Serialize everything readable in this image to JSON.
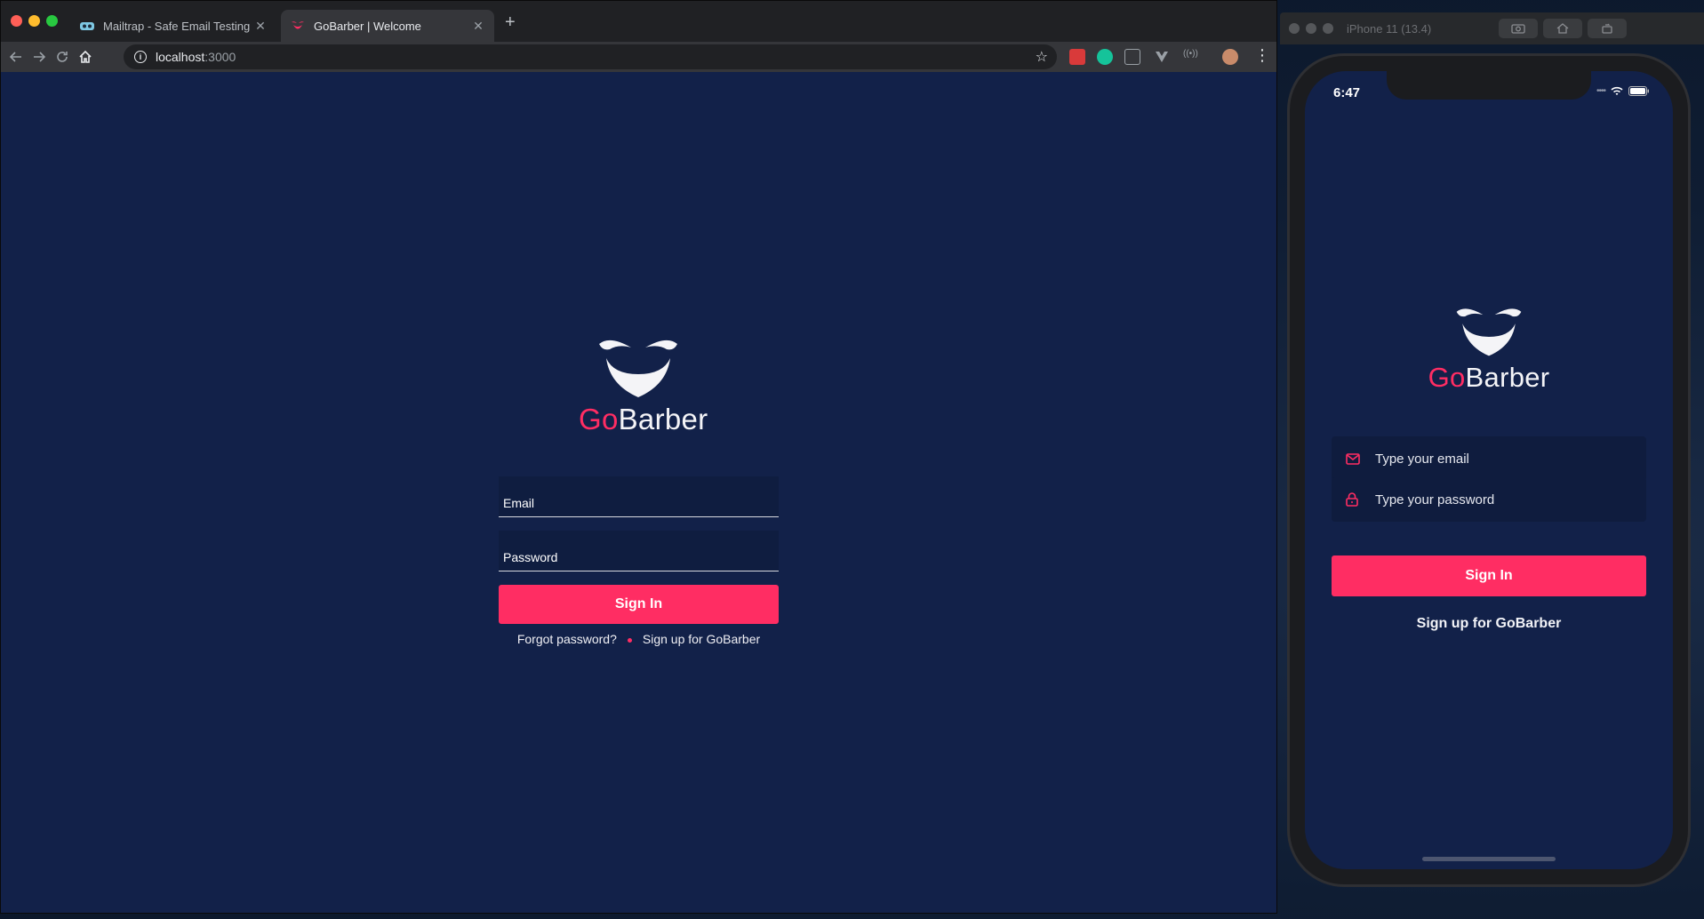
{
  "browser": {
    "tabs": [
      {
        "title": "Mailtrap - Safe Email Testing",
        "active": false
      },
      {
        "title": "GoBarber | Welcome",
        "active": true
      }
    ],
    "url_host": "localhost",
    "url_port": ":3000"
  },
  "web": {
    "brand_go": "Go",
    "brand_rest": "Barber",
    "email_placeholder": "Email",
    "password_placeholder": "Password",
    "signin_label": "Sign In",
    "forgot_label": "Forgot password?",
    "signup_label": "Sign up for GoBarber"
  },
  "simulator": {
    "title": "iPhone 11 (13.4)",
    "status_time": "6:47",
    "brand_go": "Go",
    "brand_rest": "Barber",
    "email_placeholder": "Type your email",
    "password_placeholder": "Type your password",
    "signin_label": "Sign In",
    "signup_label": "Sign up for GoBarber"
  },
  "colors": {
    "background": "#122149",
    "accent": "#ff2d63",
    "text": "#f4f4f7"
  },
  "icons": [
    "back-arrow-icon",
    "forward-arrow-icon",
    "reload-icon",
    "home-icon",
    "info-icon",
    "star-icon",
    "mail-icon",
    "lock-icon",
    "wifi-icon",
    "battery-icon",
    "beard-logo-icon"
  ]
}
